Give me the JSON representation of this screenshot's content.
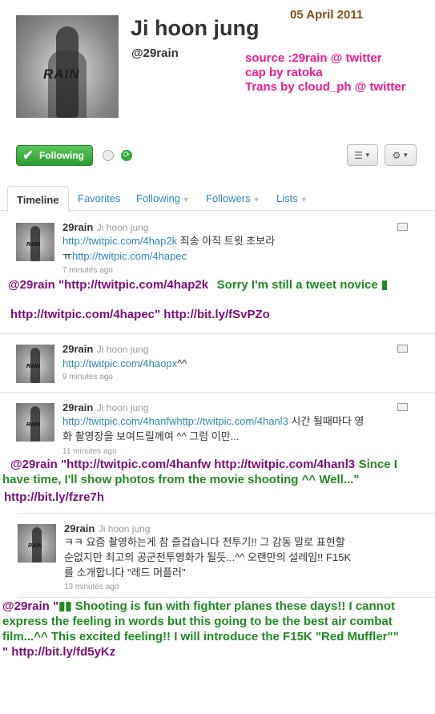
{
  "profile": {
    "name": "Ji hoon jung",
    "handle": "@29rain",
    "avatar_text": "RAIN",
    "date_overlay": "05 April 2011",
    "credits": [
      "source :29rain @ twitter",
      "cap by ratoka",
      "Trans by cloud_ph @ twitter"
    ]
  },
  "actions": {
    "follow_label": "Following"
  },
  "tabs": [
    {
      "label": "Timeline",
      "active": true
    },
    {
      "label": "Favorites"
    },
    {
      "label": "Following"
    },
    {
      "label": "Followers"
    },
    {
      "label": "Lists"
    }
  ],
  "tweets": [
    {
      "user": "29rain",
      "full_name": "Ji hoon jung",
      "link1": "http://twitpic.com/4hap2k",
      "text1": " 죄송 아직 트윗 초보라",
      "prefix2": "ㅠ",
      "link2": "http://twitpic.com/4hapec",
      "time": "7 minutes ago",
      "trans": {
        "line1_purple": "@29rain \"http://twitpic.com/4hap2k",
        "line1_green": "Sorry I'm still a tweet novice ▮",
        "line2_purple": "http://twitpic.com/4hapec\" http://bit.ly/fSvPZo"
      }
    },
    {
      "user": "29rain",
      "full_name": "Ji hoon jung",
      "link1": "http://twitpic.com/4haopx",
      "text1": "^^",
      "time": "9 minutes ago"
    },
    {
      "user": "29rain",
      "full_name": "Ji hoon jung",
      "link1": "http://twitpic.com/4hanfwhttp://twitpic.com/4hanl3",
      "text1": " 시간 될때마다 영",
      "text2": "화 촬영장을 보여드릴께여 ^^ 그럼 이만...",
      "time": "11 minutes ago",
      "trans": {
        "line1_purple": "@29rain \"http://twitpic.com/4hanfw http://twitpic.com/4hanl3",
        "line1_green": "Since I",
        "line2_green": "have time, I'll show photos from the movie shooting ^^ Well...\"",
        "line3_purple": "http://bit.ly/fzre7h"
      }
    },
    {
      "user": "29rain",
      "full_name": "Ji hoon jung",
      "text1": "ㅋㅋ 요즘 촬영하는게 참 즐겁습니다 전투기!! 그 감동 말로 표현할",
      "text2": "순없지만 최고의 공군전투영화가 될듯...^^ 오랜만의 설레임!! F15K",
      "text3": "를 소개합니다 \"레드 머플러\"",
      "time": "13 minutes ago",
      "trans": {
        "line1_purple": "@29rain \"",
        "line1_green": "▮▮ Shooting is fun with fighter planes these days!! I cannot",
        "line2_green": "express the feeling in words but this going to be the best air combat",
        "line3_green": "film...^^ This excited feeling!! I will introduce the F15K \"Red Muffler\"\"",
        "line4_purple": "\" http://bit.ly/fd5yKz"
      }
    }
  ],
  "colors": {
    "link": "#2a88b8",
    "purple": "#7d0b7d",
    "green": "#1f8a1f",
    "pink": "#ee1a8c",
    "brown": "#8a4b12"
  }
}
